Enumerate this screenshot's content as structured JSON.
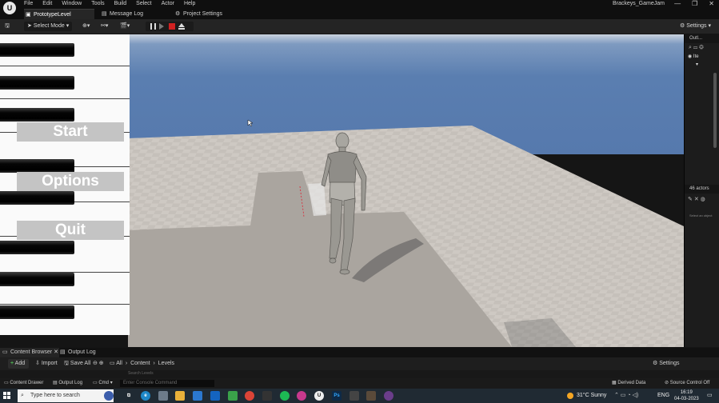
{
  "menubar": {
    "logo": "U",
    "items": [
      "File",
      "Edit",
      "Window",
      "Tools",
      "Build",
      "Select",
      "Actor",
      "Help"
    ],
    "project_name": "Brackeys_GameJam",
    "window_controls": [
      "—",
      "❐",
      "✕"
    ]
  },
  "tabs": {
    "level": "PrototypeLevel",
    "message_log": "Message Log",
    "project_settings": "Project Settings"
  },
  "toolbar": {
    "mode_label": "Select Mode",
    "settings_label": "Settings"
  },
  "game_menu": {
    "start": "Start",
    "options": "Options",
    "quit": "Quit"
  },
  "outliner": {
    "title": "Outl...",
    "row_label": "Ite",
    "actor_count": "46 actors",
    "select_hint": "Select an object"
  },
  "content_browser": {
    "tab_label": "Content Browser",
    "output_log_tab": "Output Log",
    "add_label": "Add",
    "import_label": "Import",
    "save_all_label": "Save All",
    "breadcrumb": [
      "All",
      "Content",
      "Levels"
    ],
    "settings_label": "Settings",
    "search_placeholder": "Search Levels"
  },
  "statusbar": {
    "content_drawer": "Content Drawer",
    "output_log": "Output Log",
    "cmd": "Cmd",
    "console_placeholder": "Enter Console Command",
    "derived_data": "Derived Data",
    "source_control": "Source Control Off"
  },
  "taskbar": {
    "search_placeholder": "Type here to search",
    "weather": "31°C  Sunny",
    "language": "ENG",
    "time": "16:19",
    "date": "04-03-2023"
  },
  "colors": {
    "sky": "#5a7eb0",
    "floor": "#c9c4bd",
    "stop_button": "#d02121",
    "menu_button": "#c4c4c4"
  }
}
